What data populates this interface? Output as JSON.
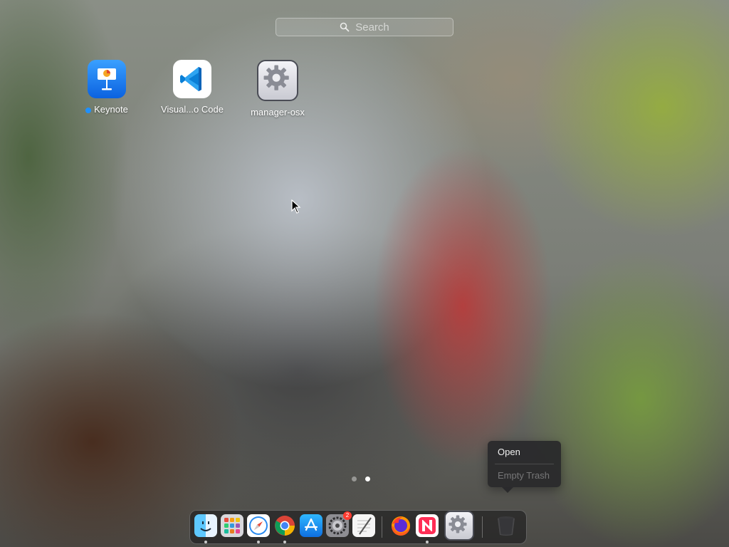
{
  "search": {
    "placeholder": "Search"
  },
  "apps": [
    {
      "label": "Keynote",
      "icon": "keynote-icon",
      "new": true
    },
    {
      "label": "Visual...o Code",
      "icon": "vscode-icon"
    },
    {
      "label": "manager-osx",
      "icon": "gear-app-icon"
    }
  ],
  "pages": {
    "count": 2,
    "active": 2
  },
  "context_menu": {
    "items": [
      {
        "label": "Open",
        "enabled": true
      },
      {
        "label": "Empty Trash",
        "enabled": false
      }
    ]
  },
  "dock": {
    "items": [
      {
        "name": "finder-icon",
        "running": true
      },
      {
        "name": "launchpad-icon",
        "running": false
      },
      {
        "name": "safari-icon",
        "running": true
      },
      {
        "name": "chrome-icon",
        "running": true
      },
      {
        "name": "app-store-icon",
        "running": false
      },
      {
        "name": "system-preferences-icon",
        "running": false,
        "badge": "2"
      },
      {
        "name": "textedit-icon",
        "running": false
      },
      {
        "name": "firefox-icon",
        "running": false
      },
      {
        "name": "news-icon",
        "running": true
      },
      {
        "name": "manager-osx-dock-icon",
        "running": false
      },
      {
        "name": "trash-icon",
        "running": false
      }
    ]
  },
  "colors": {
    "accent": "#1e90ff",
    "badge": "#ff3b30"
  }
}
